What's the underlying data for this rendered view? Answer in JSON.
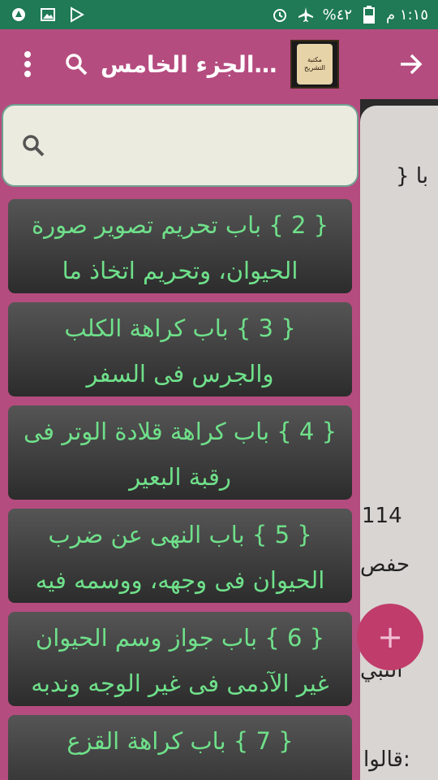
{
  "status_bar": {
    "time": "١:١٥ م",
    "battery": "%٤٢"
  },
  "appbar": {
    "title": "الجزء الخامس...",
    "logo_text": "مكتبة التشريح"
  },
  "search": {
    "placeholder": ""
  },
  "drawer_items": [
    {
      "line1": "{ 2 } باب تحريم تصوير صورة",
      "line2": "الحيوان، وتحريم اتخاذ ما"
    },
    {
      "line1": "{ 3 } باب كراهة الكلب",
      "line2": "والجرس فى السفر"
    },
    {
      "line1": "{ 4 } باب كراهة قلادة الوتر فى",
      "line2": "رقبة البعير"
    },
    {
      "line1": "{ 5 } باب النهى عن ضرب",
      "line2": "الحيوان فى وجهه، ووسمه فيه"
    },
    {
      "line1": "{ 6 } باب جواز وسم الحيوان",
      "line2": "غير الآدمى فى غير الوجه وندبه"
    },
    {
      "line1": "",
      "line2": "{ 7 } باب كراهة القزع"
    }
  ],
  "background": {
    "t1": "} با",
    "t2": "114",
    "t3": "حفص",
    "t4": "النبي",
    "t5": "قالوا:"
  },
  "fab_label": "+",
  "colors": {
    "status": "#1f7a55",
    "appbar": "#b54c7f",
    "item_text": "#6fe08a"
  }
}
